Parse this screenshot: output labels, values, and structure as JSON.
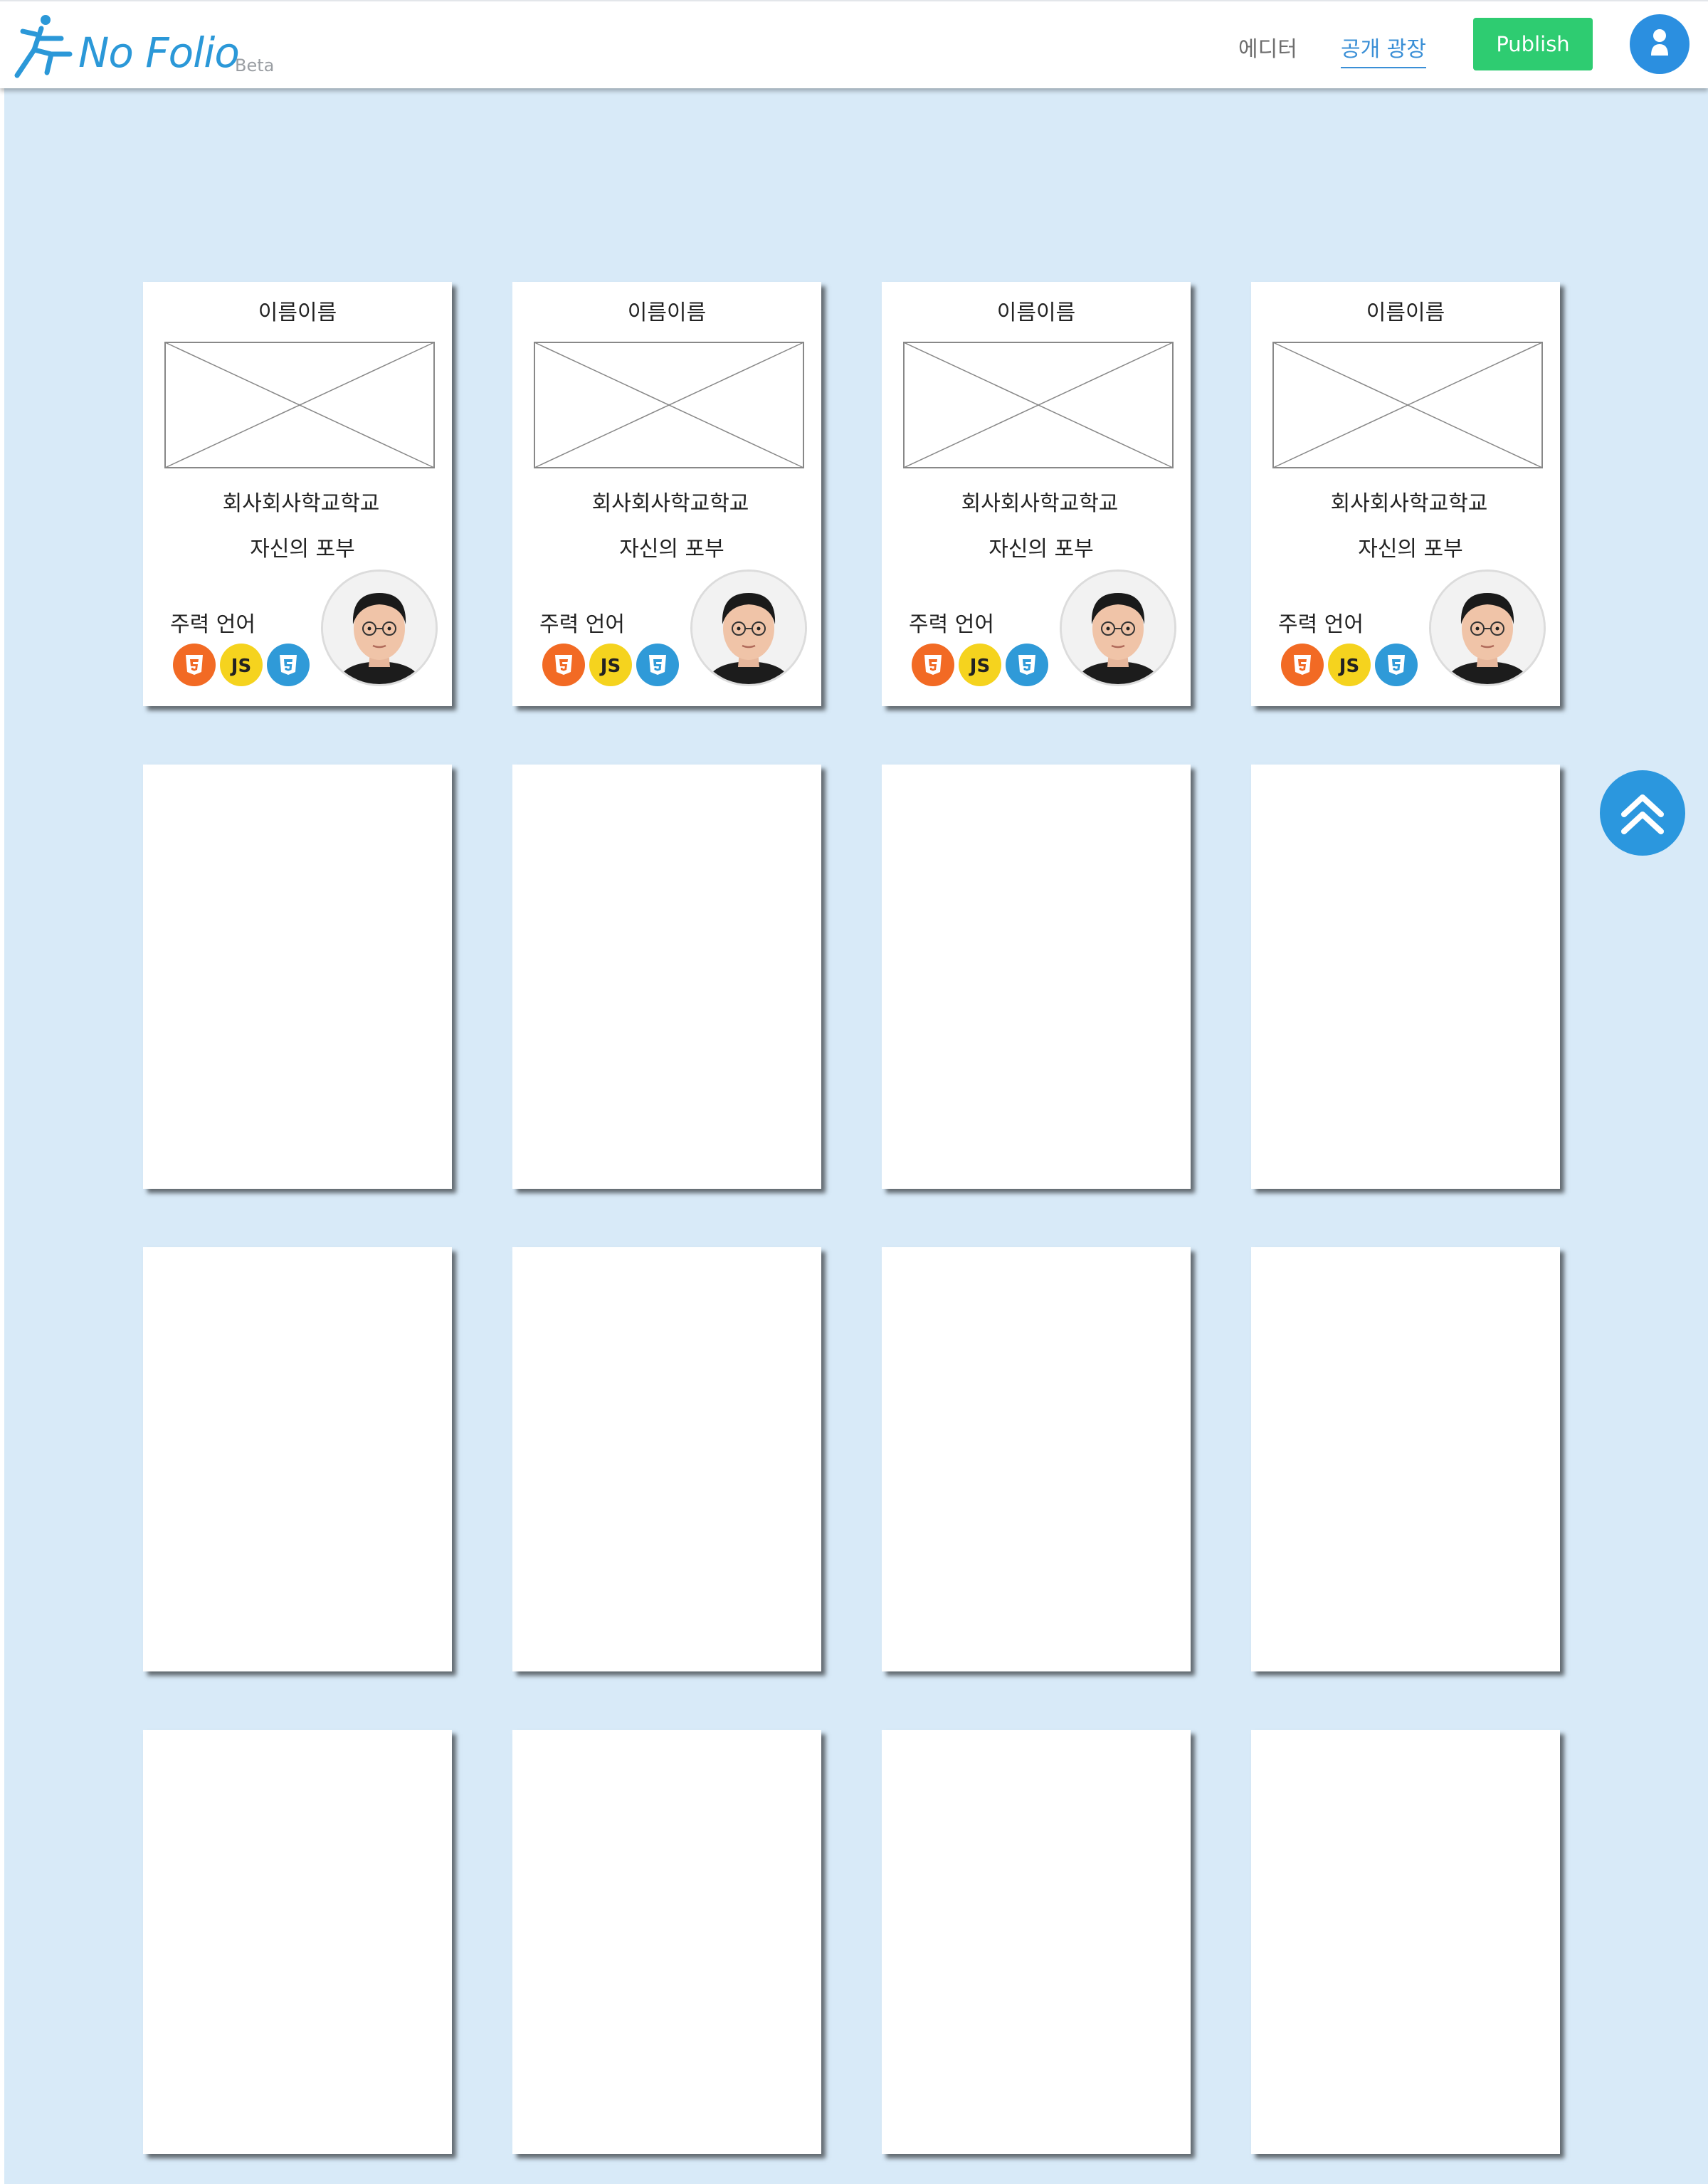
{
  "header": {
    "logo_text": "No Folio",
    "logo_beta": "Beta",
    "nav": {
      "editor": "에디터",
      "plaza": "공개 광장"
    },
    "publish_label": "Publish",
    "avatar_icon": "user-icon",
    "colors": {
      "brand": "#2b98d8",
      "publish": "#2ecc71",
      "avatar": "#2b8fe0"
    }
  },
  "main": {
    "background": "#d8eaf8",
    "cards": [
      {
        "name": "이름이름",
        "company": "회사회사학교학교",
        "bio": "자신의 포부",
        "lang_label": "주력 언어",
        "languages": [
          "html5-icon",
          "javascript-icon",
          "css3-icon"
        ]
      },
      {
        "name": "이름이름",
        "company": "회사회사학교학교",
        "bio": "자신의 포부",
        "lang_label": "주력 언어",
        "languages": [
          "html5-icon",
          "javascript-icon",
          "css3-icon"
        ]
      },
      {
        "name": "이름이름",
        "company": "회사회사학교학교",
        "bio": "자신의 포부",
        "lang_label": "주력 언어",
        "languages": [
          "html5-icon",
          "javascript-icon",
          "css3-icon"
        ]
      },
      {
        "name": "이름이름",
        "company": "회사회사학교학교",
        "bio": "자신의 포부",
        "lang_label": "주력 언어",
        "languages": [
          "html5-icon",
          "javascript-icon",
          "css3-icon"
        ]
      }
    ],
    "empty_card_rows": 3,
    "scroll_top_icon": "double-chevron-up-icon"
  }
}
